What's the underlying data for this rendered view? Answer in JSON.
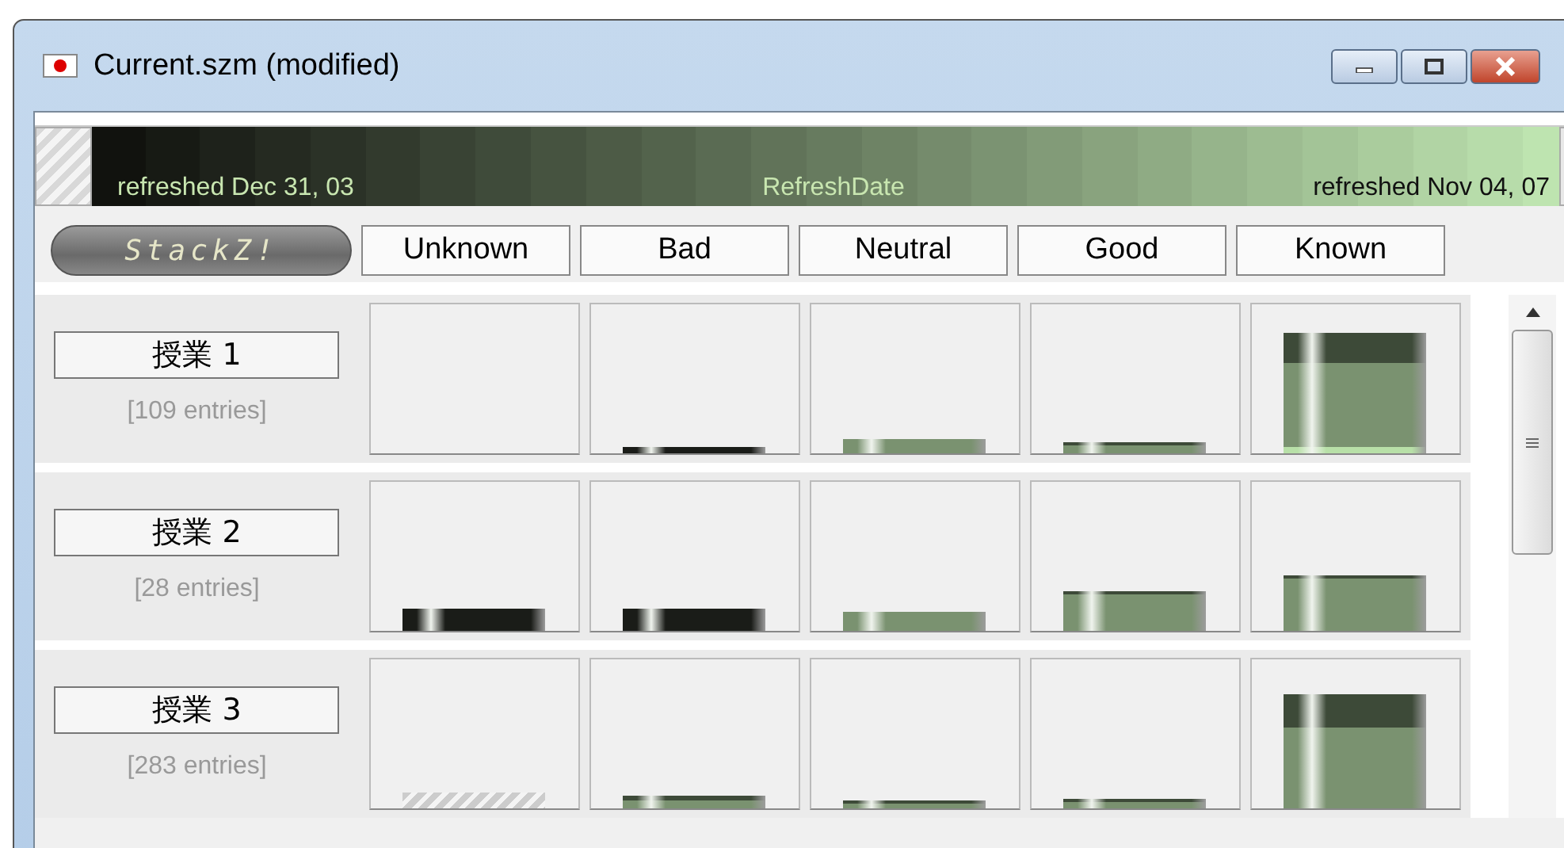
{
  "window": {
    "title": "Current.szm (modified)"
  },
  "date_range": {
    "start_label": "refreshed Dec 31, 03",
    "center_label": "RefreshDate",
    "end_label": "refreshed Nov 04, 07"
  },
  "logo_button": {
    "label": "StackZ!"
  },
  "columns": [
    "Unknown",
    "Bad",
    "Neutral",
    "Good",
    "Known"
  ],
  "rows": [
    {
      "name": "授業 1",
      "entries": "[109 entries]"
    },
    {
      "name": "授業 2",
      "entries": "[28 entries]"
    },
    {
      "name": "授業 3",
      "entries": "[283 entries]"
    }
  ]
}
